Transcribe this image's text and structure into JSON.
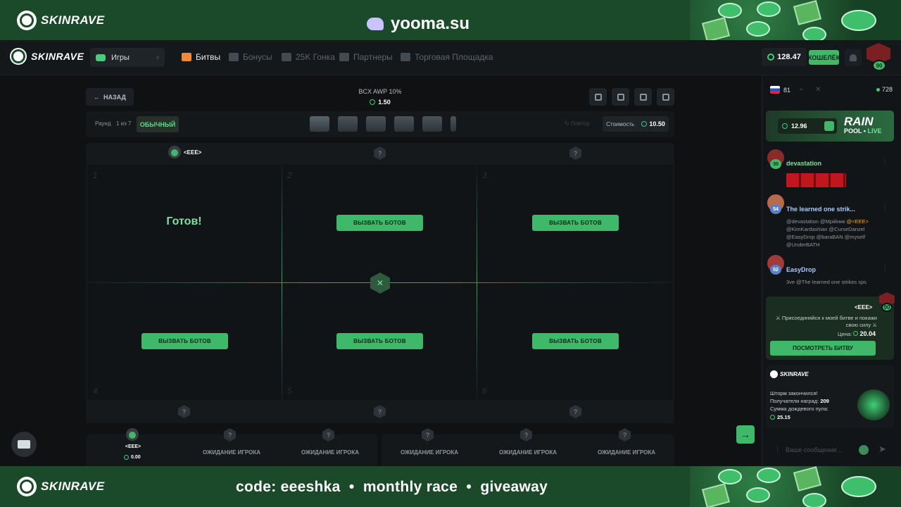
{
  "stream": {
    "brand": "SKINRAVE",
    "site": "yooma.su",
    "footer_text": "code: eeeshka  •  monthly race  •  giveaway"
  },
  "nav": {
    "brand": "SKINRAVE",
    "games_label": "Игры",
    "items": [
      {
        "label": "Битвы",
        "icon": "battles-icon"
      },
      {
        "label": "Бонусы",
        "icon": "gift-icon"
      },
      {
        "label": "25K Гонка",
        "icon": "flag-icon"
      },
      {
        "label": "Партнеры",
        "icon": "partners-icon"
      },
      {
        "label": "Торговая Площадка",
        "icon": "market-icon"
      }
    ],
    "balance": "128.47",
    "wallet_label": "КОШЕЛЁК",
    "user_level": "90"
  },
  "battle": {
    "back_label": "НАЗАД",
    "case_title": "BCX AWP 10%",
    "case_price": "1.50",
    "round_label": "Раунд",
    "round_value": "1 из 7",
    "mode": "ОБЫЧНЫЙ",
    "repeat_label": "Повтор",
    "cost_label": "Стоимость",
    "cost_value": "10.50",
    "player_name": "<EEE>",
    "player_level": "90",
    "ready_text": "Готов!",
    "call_bots_label": "ВЫЗВАТЬ БОТОВ",
    "slot_numbers": [
      "1",
      "2",
      "3",
      "4",
      "5",
      "6"
    ],
    "unknown_mark": "?",
    "player_total": "0.00",
    "waiting_label": "ОЖИДАНИЕ ИГРОКА",
    "next_arrow": "→"
  },
  "chat": {
    "online_count_left": "81",
    "online_count_right": "728",
    "rain": {
      "amount": "12.96",
      "title": "RAIN",
      "pool": "POOL",
      "live": "LIVE"
    },
    "messages": [
      {
        "name": "devastation",
        "level": "30",
        "text": ""
      },
      {
        "name": "The learned one strik...",
        "level": "54",
        "text_parts": [
          "@devastation @Мрійник ",
          "@<EEE>",
          " @KimKardashian @CurseDanzel @EasyDrop @baraBAN @myself @UnderBATH"
        ]
      },
      {
        "name": "EasyDrop",
        "level": "52",
        "text": "3ve @The learned one strikes sps"
      }
    ],
    "battle_invite": {
      "name": "<EEE>",
      "level": "90",
      "text": "⚔ Присоединяйся к моей битве и покажи свою силу ⚔",
      "price_label": "Цена:",
      "price": "20.04",
      "button": "ПОСМОТРЕТЬ БИТВУ"
    },
    "storm": {
      "brand": "SKINRAVE",
      "line1": "Шторм закончился!",
      "line2_label": "Получатели наград:",
      "line2_value": "209",
      "line3": "Сумма дождевого пула:",
      "line4": "25.15"
    },
    "input_placeholder": "Ваше сообщение..."
  }
}
